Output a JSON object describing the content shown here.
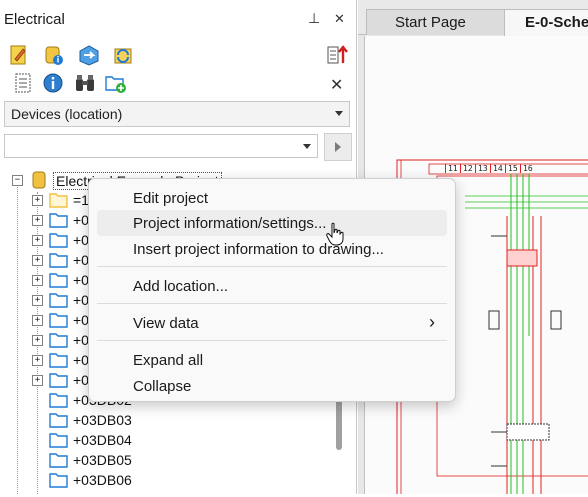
{
  "panel": {
    "title": "Electrical",
    "pin_glyph": "⊥",
    "close_glyph": "✕",
    "toolbar_close_glyph": "✕",
    "view_select": "Devices (location)",
    "search_value": ""
  },
  "tree": {
    "root_label": "Electrical Example Project",
    "children": [
      "=1",
      "+0",
      "+0",
      "+0",
      "+0",
      "+0",
      "+0",
      "+0",
      "+0",
      "+0",
      "+03DB02",
      "+03DB03",
      "+03DB04",
      "+03DB05",
      "+03DB06"
    ],
    "expand_glyph": "+",
    "collapse_glyph": "−"
  },
  "tabs": {
    "start_page": "Start Page",
    "active": "E-0-Sche"
  },
  "context_menu": {
    "items": [
      {
        "label": "Edit project"
      },
      {
        "label": "Project information/settings..."
      },
      {
        "label": "Insert project information to drawing..."
      },
      {
        "label": "Add location..."
      },
      {
        "label": "View data",
        "submenu_glyph": "›"
      },
      {
        "label": "Expand all"
      },
      {
        "label": "Collapse"
      }
    ]
  },
  "drawing": {
    "column_numbers": [
      "11",
      "12",
      "13",
      "14",
      "15",
      "16"
    ]
  },
  "colors": {
    "accent_red": "#e02020",
    "accent_green": "#22c022",
    "folder_blue": "#1f7ad6",
    "folder_yellow": "#f0c040"
  }
}
